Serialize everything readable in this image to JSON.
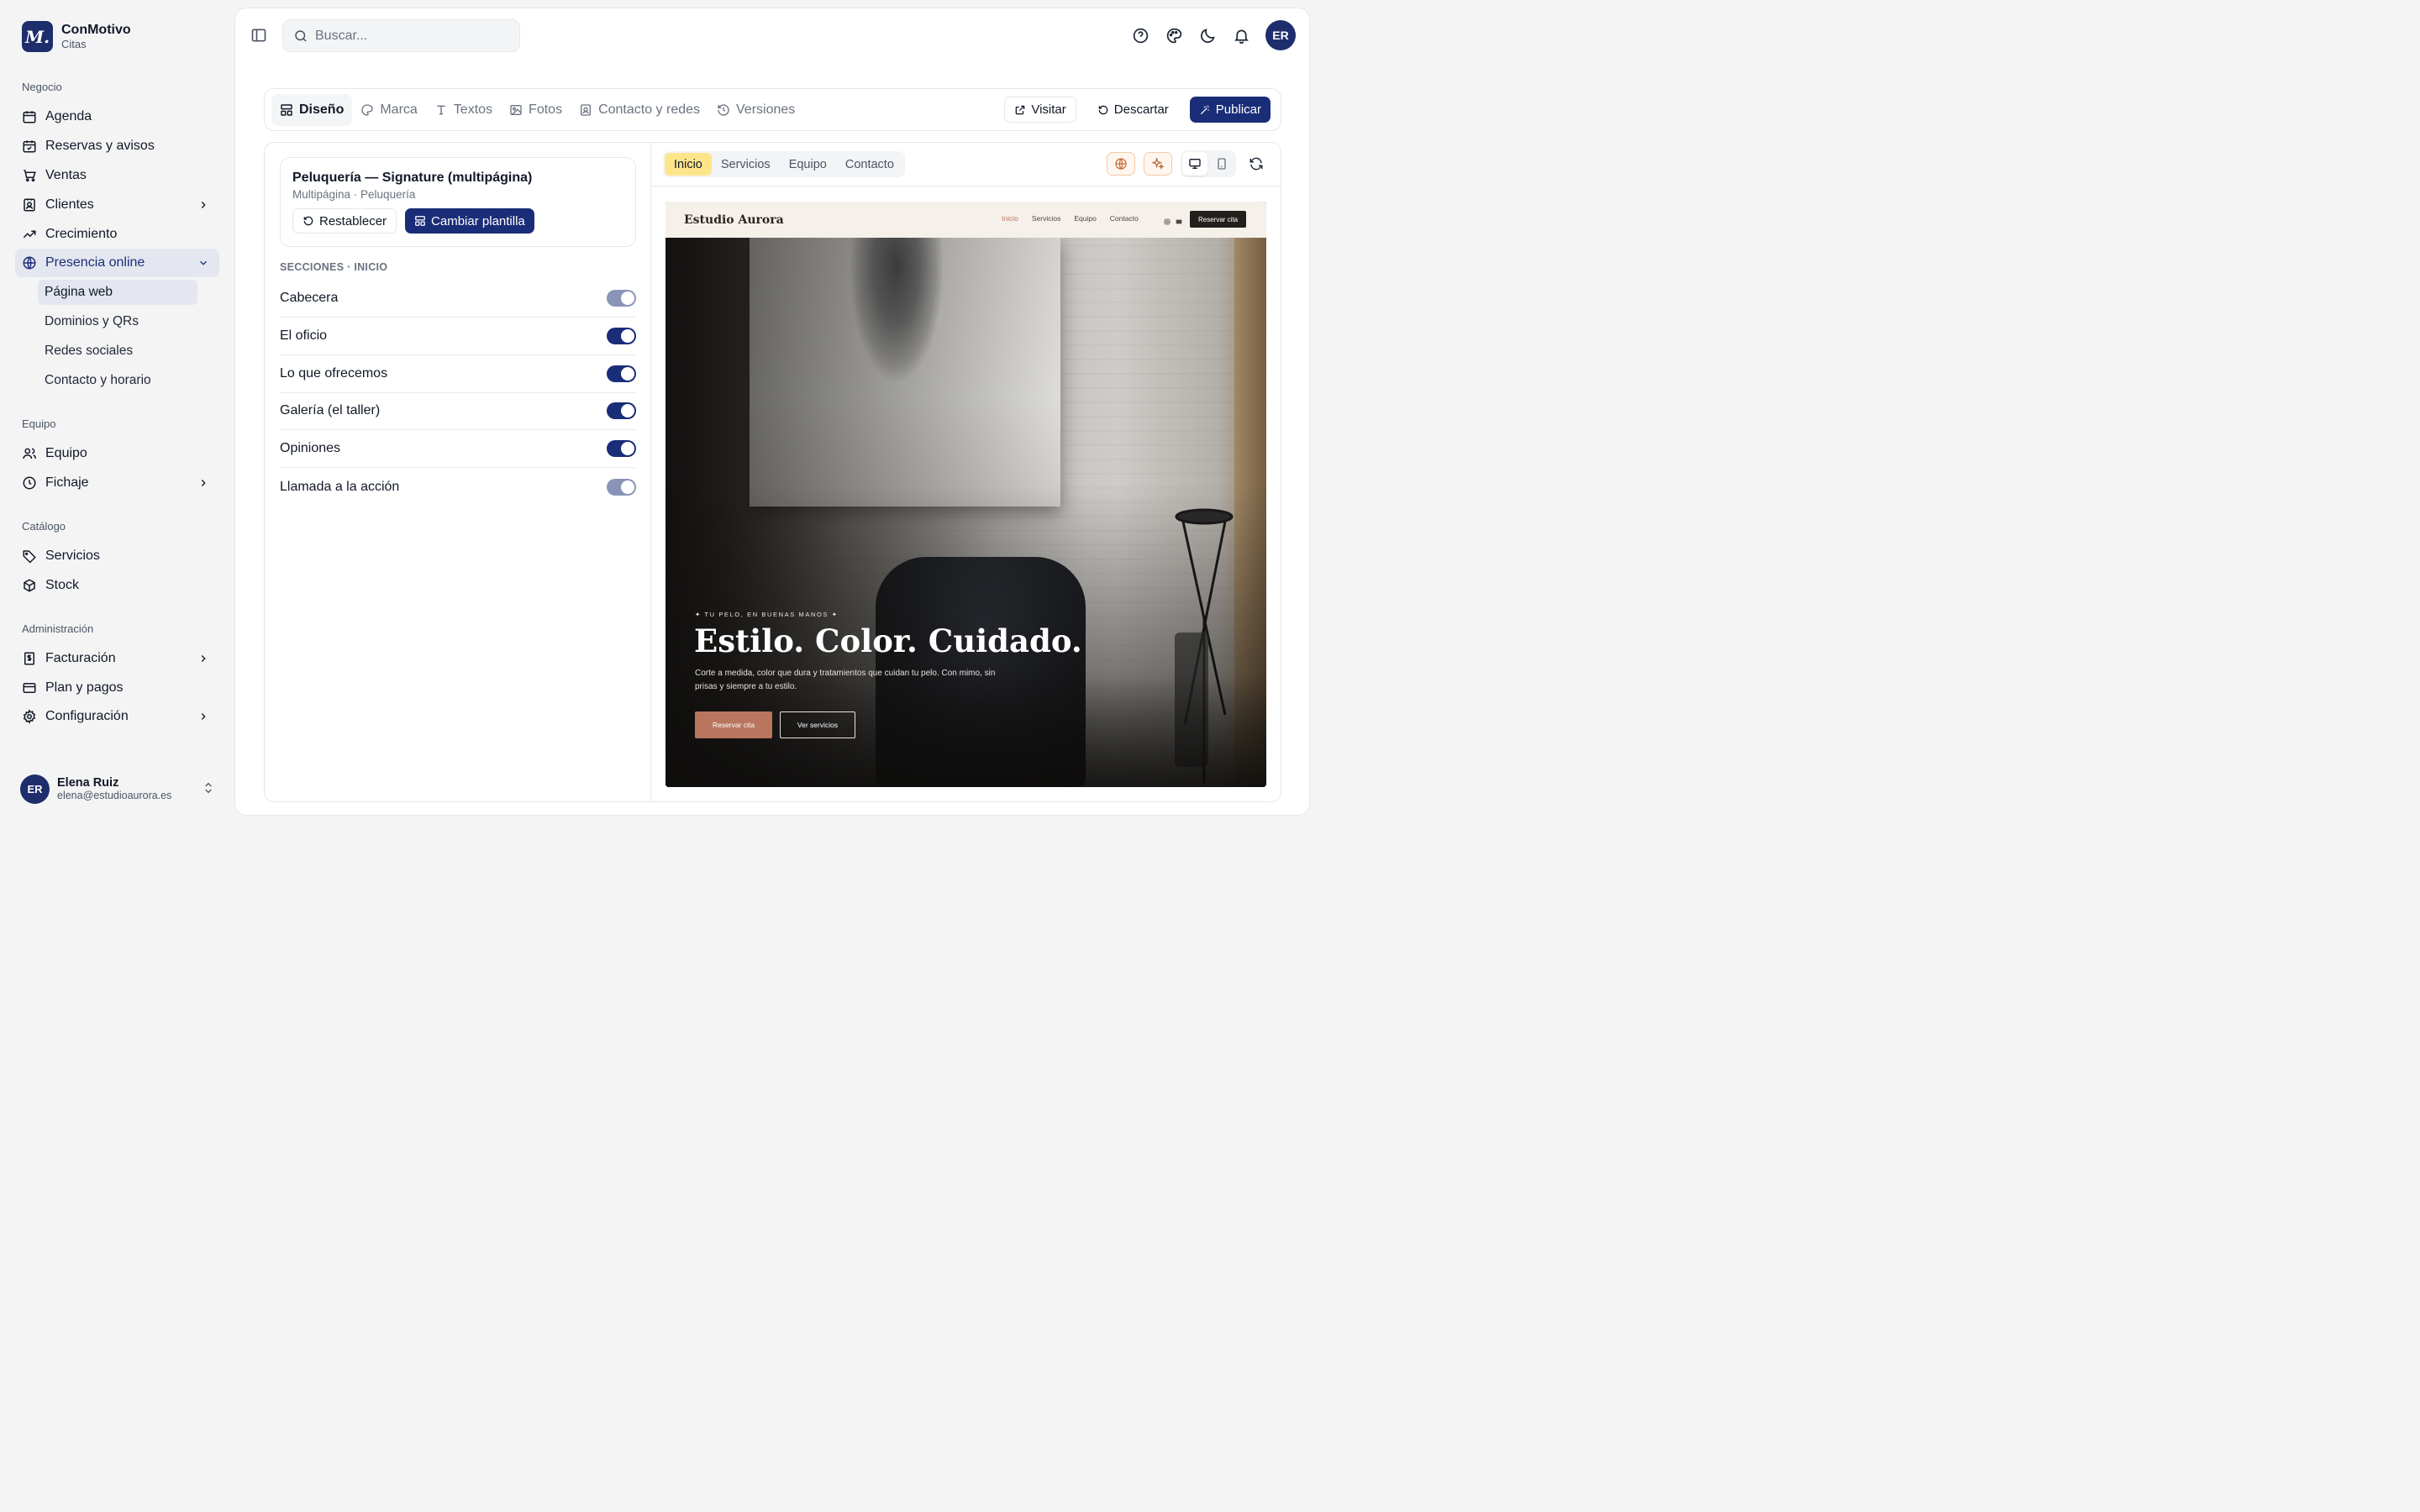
{
  "brand": {
    "logo": "M.",
    "name": "ConMotivo",
    "subtitle": "Citas"
  },
  "sidebar": {
    "groups": [
      {
        "label": "Negocio"
      },
      {
        "label": "Equipo"
      },
      {
        "label": "Catálogo"
      },
      {
        "label": "Administración"
      }
    ],
    "items": {
      "agenda": "Agenda",
      "reservas": "Reservas y avisos",
      "ventas": "Ventas",
      "clientes": "Clientes",
      "crecimiento": "Crecimiento",
      "presencia": "Presencia online",
      "pagina_web": "Página web",
      "dominios": "Dominios y QRs",
      "redes": "Redes sociales",
      "contacto_horario": "Contacto y horario",
      "equipo": "Equipo",
      "fichaje": "Fichaje",
      "servicios": "Servicios",
      "stock": "Stock",
      "facturacion": "Facturación",
      "plan": "Plan y pagos",
      "configuracion": "Configuración"
    },
    "user": {
      "initials": "ER",
      "name": "Elena Ruiz",
      "email": "elena@estudioaurora.es"
    }
  },
  "header": {
    "search_placeholder": "Buscar...",
    "avatar_initials": "ER"
  },
  "editor_tabs": {
    "tabs": [
      "Diseño",
      "Marca",
      "Textos",
      "Fotos",
      "Contacto y redes",
      "Versiones"
    ],
    "active": "Diseño",
    "visit": "Visitar",
    "discard": "Descartar",
    "publish": "Publicar"
  },
  "template": {
    "title": "Peluquería — Signature (multipágina)",
    "subtitle": "Multipágina · Peluquería",
    "reset": "Restablecer",
    "change": "Cambiar plantilla"
  },
  "sections": {
    "label": "SECCIONES · INICIO",
    "rows": [
      {
        "name": "Cabecera",
        "enabled": true,
        "locked": true
      },
      {
        "name": "El oficio",
        "enabled": true,
        "locked": false
      },
      {
        "name": "Lo que ofrecemos",
        "enabled": true,
        "locked": false
      },
      {
        "name": "Galería (el taller)",
        "enabled": true,
        "locked": false
      },
      {
        "name": "Opiniones",
        "enabled": true,
        "locked": false
      },
      {
        "name": "Llamada a la acción",
        "enabled": true,
        "locked": true
      }
    ]
  },
  "preview": {
    "page_tabs": [
      "Inicio",
      "Servicios",
      "Equipo",
      "Contacto"
    ],
    "active_page": "Inicio",
    "device": "desktop",
    "site": {
      "brand": "Estudio Aurora",
      "links": [
        "Inicio",
        "Servicios",
        "Equipo",
        "Contacto"
      ],
      "cta": "Reservar cita",
      "kicker": "✦ TU PELO, EN BUENAS MANOS ✦",
      "title": "Estilo. Color. Cuidado.",
      "description": "Corte a medida, color que dura y tratamientos que cuidan tu pelo. Con mimo, sin prisas y siempre a tu estilo.",
      "primary_button": "Reservar cita",
      "secondary_button": "Ver servicios"
    }
  },
  "colors": {
    "primary": "#1a2d78",
    "accent": "#b8765f",
    "highlight": "#fde68a"
  }
}
